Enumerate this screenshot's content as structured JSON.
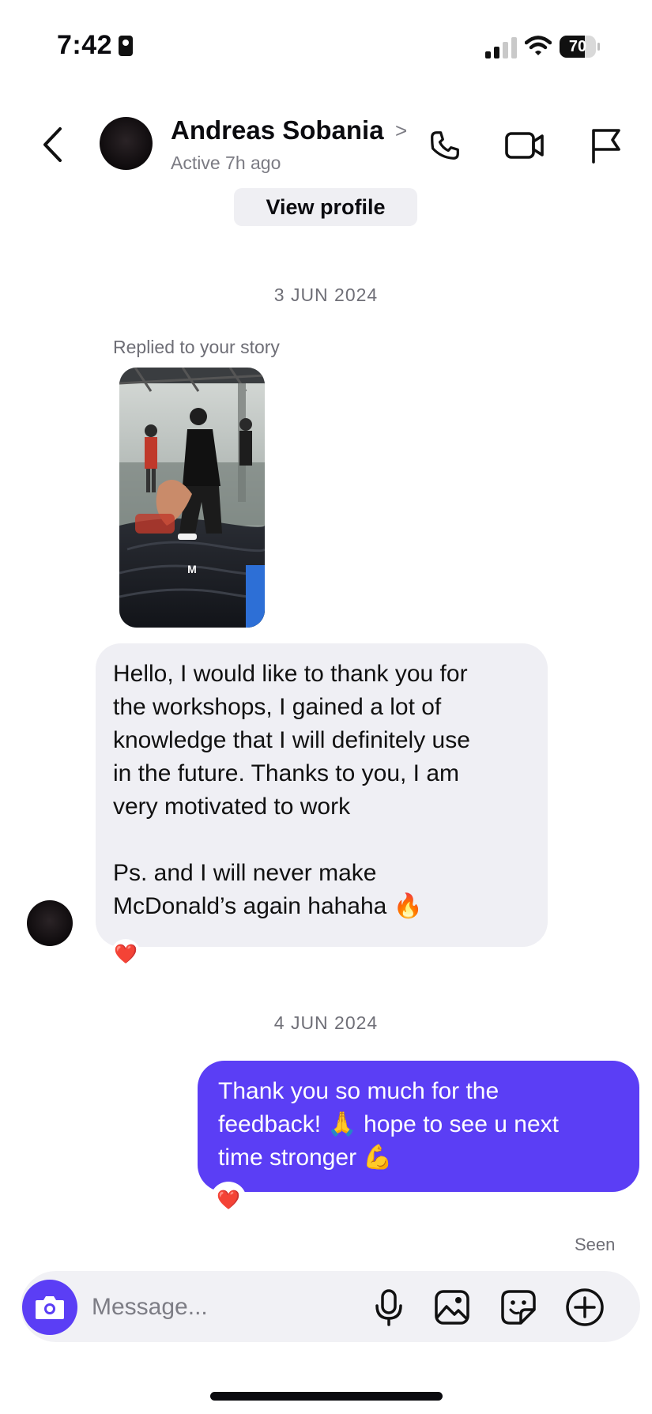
{
  "status_bar": {
    "time": "7:42",
    "battery": "70",
    "battery_level": 0.7
  },
  "header": {
    "contact_name": "Andreas Sobania",
    "chevron": ">",
    "active_status": "Active 7h ago",
    "view_profile_label": "View profile",
    "icons": [
      "back-chevron-icon",
      "phone-icon",
      "video-camera-icon",
      "flag-icon"
    ]
  },
  "thread": {
    "date_1": "3 JUN 2024",
    "replied_label": "Replied to your story",
    "story_caption": "M",
    "incoming_message": "Hello, I would like to thank you for\nthe workshops, I gained a lot of\nknowledge that I will definitely use\nin the future. Thanks to you, I am\nvery motivated to work\n\nPs. and I will never make\nMcDonald’s again hahaha 🔥",
    "incoming_reaction": "❤️",
    "date_2": "4 JUN 2024",
    "outgoing_message": "Thank you so much for the\nfeedback! 🙏 hope to see u next\ntime stronger 💪",
    "outgoing_reaction": "❤️",
    "seen_label": "Seen"
  },
  "composer": {
    "placeholder": "Message...",
    "icons": [
      "camera-icon",
      "microphone-icon",
      "gallery-icon",
      "sticker-icon",
      "plus-circle-icon"
    ]
  },
  "colors": {
    "accent": "#5b3ef5",
    "incoming_bubble": "#efeff4",
    "text_muted": "#6e6e76"
  }
}
